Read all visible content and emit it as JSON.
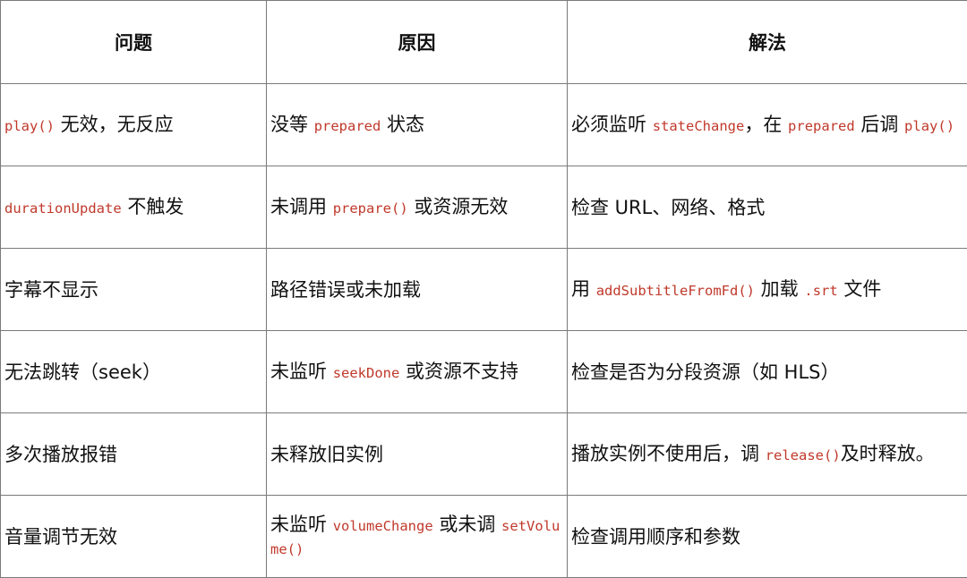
{
  "table": {
    "headers": [
      "问题",
      "原因",
      "解法"
    ],
    "rows": [
      [
        [
          {
            "t": "code",
            "v": "play()"
          },
          {
            "t": "text",
            "v": " 无效，无反应"
          }
        ],
        [
          {
            "t": "text",
            "v": "没等 "
          },
          {
            "t": "code",
            "v": "prepared"
          },
          {
            "t": "text",
            "v": " 状态"
          }
        ],
        [
          {
            "t": "text",
            "v": "必须监听 "
          },
          {
            "t": "code",
            "v": "stateChange"
          },
          {
            "t": "text",
            "v": "，在 "
          },
          {
            "t": "code",
            "v": "prepared"
          },
          {
            "t": "text",
            "v": " 后调 "
          },
          {
            "t": "code",
            "v": "play()"
          }
        ]
      ],
      [
        [
          {
            "t": "code",
            "v": "durationUpdate"
          },
          {
            "t": "text",
            "v": " 不触发"
          }
        ],
        [
          {
            "t": "text",
            "v": "未调用 "
          },
          {
            "t": "code",
            "v": "prepare()"
          },
          {
            "t": "text",
            "v": " 或资源无效"
          }
        ],
        [
          {
            "t": "text",
            "v": "检查 URL、网络、格式"
          }
        ]
      ],
      [
        [
          {
            "t": "text",
            "v": "字幕不显示"
          }
        ],
        [
          {
            "t": "text",
            "v": "路径错误或未加载"
          }
        ],
        [
          {
            "t": "text",
            "v": "用 "
          },
          {
            "t": "code",
            "v": "addSubtitleFromFd()"
          },
          {
            "t": "text",
            "v": " 加载 "
          },
          {
            "t": "code",
            "v": ".srt"
          },
          {
            "t": "text",
            "v": " 文件"
          }
        ]
      ],
      [
        [
          {
            "t": "text",
            "v": "无法跳转（seek）"
          }
        ],
        [
          {
            "t": "text",
            "v": "未监听 "
          },
          {
            "t": "code",
            "v": "seekDone"
          },
          {
            "t": "text",
            "v": " 或资源不支持"
          }
        ],
        [
          {
            "t": "text",
            "v": "检查是否为分段资源（如 HLS）"
          }
        ]
      ],
      [
        [
          {
            "t": "text",
            "v": "多次播放报错"
          }
        ],
        [
          {
            "t": "text",
            "v": "未释放旧实例"
          }
        ],
        [
          {
            "t": "text",
            "v": "播放实例不使用后，调 "
          },
          {
            "t": "code",
            "v": "release()"
          },
          {
            "t": "text",
            "v": "及时释放。"
          }
        ]
      ],
      [
        [
          {
            "t": "text",
            "v": "音量调节无效"
          }
        ],
        [
          {
            "t": "text",
            "v": "未监听 "
          },
          {
            "t": "code",
            "v": "volumeChange"
          },
          {
            "t": "text",
            "v": " 或未调 "
          },
          {
            "t": "code",
            "v": "setVolume()"
          }
        ],
        [
          {
            "t": "text",
            "v": "检查调用顺序和参数"
          }
        ]
      ]
    ]
  },
  "colors": {
    "code_text": "#c0392b",
    "border": "#7a7a7a",
    "text": "#111111",
    "background": "#ffffff"
  }
}
